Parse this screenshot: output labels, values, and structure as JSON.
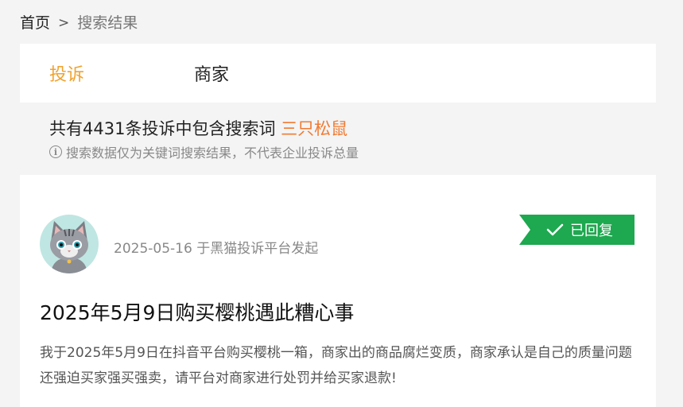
{
  "breadcrumb": {
    "home": "首页",
    "separator": ">",
    "current": "搜索结果"
  },
  "tabs": [
    {
      "label": "投诉",
      "active": true
    },
    {
      "label": "商家",
      "active": false
    }
  ],
  "summary": {
    "prefix": "共有4431条投诉中包含搜索词",
    "keyword": "三只松鼠",
    "note": "搜索数据仅为关键词搜索结果，不代表企业投诉总量"
  },
  "complaint": {
    "meta": "2025-05-16 于黑猫投诉平台发起",
    "status": "已回复",
    "title": "2025年5月9日购买樱桃遇此糟心事",
    "body": "我于2025年5月9日在抖音平台购买樱桃一箱，商家出的商品腐烂变质，商家承认是自己的质量问题还强迫买家强买强卖，请平台对商家进行处罚并给买家退款!"
  },
  "colors": {
    "accent": "#f0a22e",
    "keyword": "#f07b33",
    "status_green": "#1ea84f",
    "avatar_bg": "#bfe6e2"
  },
  "icons": {
    "info": "info-icon",
    "check": "check-icon",
    "avatar": "cat-avatar-icon"
  }
}
